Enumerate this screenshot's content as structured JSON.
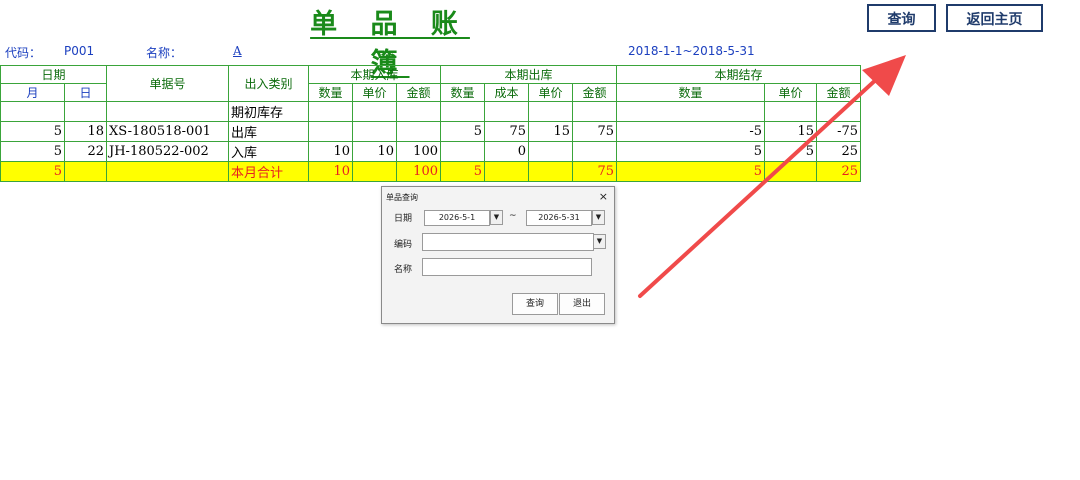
{
  "title": "单 品 账 簿",
  "buttons": {
    "query": "查询",
    "home": "返回主页"
  },
  "info": {
    "code_label": "代码：",
    "code_value": "P001",
    "name_label": "名称：",
    "name_value": "A",
    "date_range": "2018-1-1~2018-5-31"
  },
  "headers": {
    "date": "日期",
    "month": "月",
    "day": "日",
    "doc_no": "单据号",
    "type": "出入类别",
    "in": "本期入库",
    "out": "本期出库",
    "balance": "本期结存",
    "qty": "数量",
    "price": "单价",
    "amount": "金额",
    "cost": "成本"
  },
  "rows": [
    {
      "month": "",
      "day": "",
      "doc": "",
      "type": "期初库存",
      "in_qty": "",
      "in_price": "",
      "in_amt": "",
      "out_qty": "",
      "out_cost": "",
      "out_price": "",
      "out_amt": "",
      "bal_qty": "",
      "bal_price": "",
      "bal_amt": ""
    },
    {
      "month": "5",
      "day": "18",
      "doc": "XS-180518-001",
      "type": "出库",
      "in_qty": "",
      "in_price": "",
      "in_amt": "",
      "out_qty": "5",
      "out_cost": "75",
      "out_price": "15",
      "out_amt": "75",
      "bal_qty": "-5",
      "bal_price": "15",
      "bal_amt": "-75"
    },
    {
      "month": "5",
      "day": "22",
      "doc": "JH-180522-002",
      "type": "入库",
      "in_qty": "10",
      "in_price": "10",
      "in_amt": "100",
      "out_qty": "",
      "out_cost": "0",
      "out_price": "",
      "out_amt": "",
      "bal_qty": "5",
      "bal_price": "5",
      "bal_amt": "25"
    },
    {
      "month": "5",
      "day": "",
      "doc": "",
      "type": "本月合计",
      "in_qty": "10",
      "in_price": "",
      "in_amt": "100",
      "out_qty": "5",
      "out_cost": "",
      "out_price": "",
      "out_amt": "75",
      "bal_qty": "5",
      "bal_price": "",
      "bal_amt": "25"
    }
  ],
  "dialog": {
    "title": "单品查询",
    "close": "×",
    "date_label": "日期",
    "date_from": "2026-5-1",
    "tilde": "~",
    "date_to": "2026-5-31",
    "code_label": "编码",
    "code_value": "",
    "name_label": "名称",
    "name_value": "",
    "query_button": "查询",
    "exit_button": "退出"
  },
  "colors": {
    "arrow": "#f04a4a",
    "title": "#1a8a1a",
    "total_bg": "#ffff00",
    "total_text": "#e82020",
    "grid": "#3aa43a"
  }
}
